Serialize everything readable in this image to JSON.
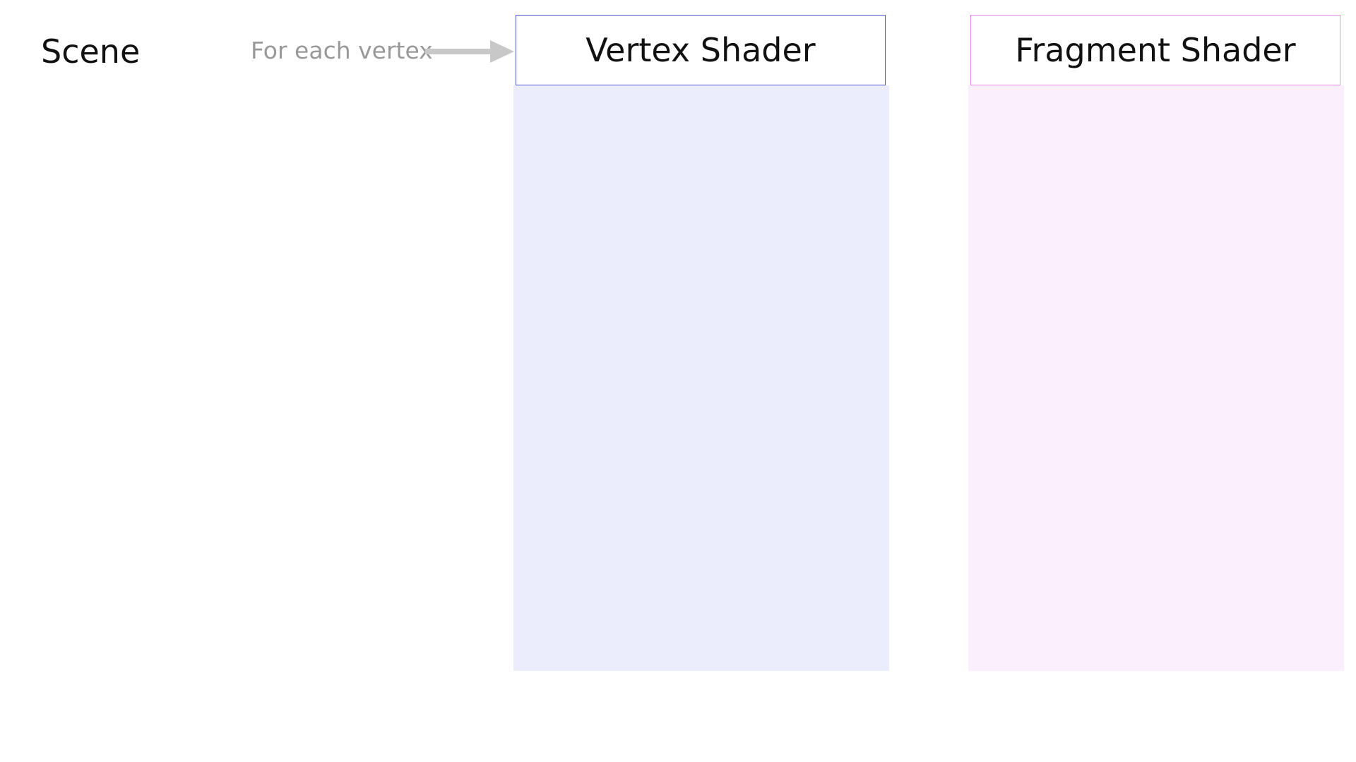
{
  "scene": {
    "title": "Scene",
    "note": "For each vertex"
  },
  "stages": {
    "vertex": {
      "title": "Vertex Shader",
      "border_color": "#4f56d8",
      "fill_color": "#ebedfc"
    },
    "fragment": {
      "title": "Fragment Shader",
      "border_color": "#e88ae8",
      "fill_color": "#fbeffd"
    }
  },
  "colors": {
    "arrow": "#c8c8c8",
    "note_text": "#999999"
  }
}
